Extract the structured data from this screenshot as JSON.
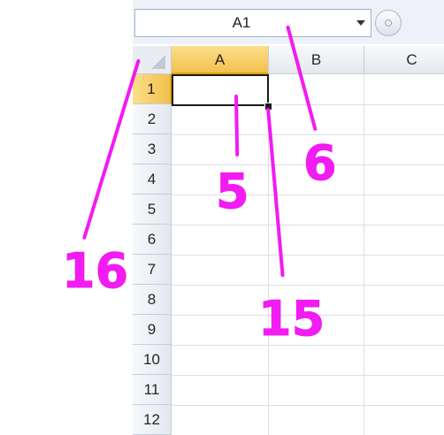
{
  "name_box": {
    "value": "A1",
    "dropdown_icon": "chevron-down-icon"
  },
  "formula_bar": {
    "button_icon": "circle-button-icon"
  },
  "columns": [
    {
      "label": "A",
      "active": true
    },
    {
      "label": "B",
      "active": false
    },
    {
      "label": "C",
      "active": false
    }
  ],
  "rows": [
    "1",
    "2",
    "3",
    "4",
    "5",
    "6",
    "7",
    "8",
    "9",
    "10",
    "11",
    "12"
  ],
  "active_cell": "A1",
  "annotations": {
    "label_5": "5",
    "label_6": "6",
    "label_15": "15",
    "label_16": "16",
    "color": "#f21bf2"
  },
  "colors": {
    "active_header": "#f2c04c",
    "header": "#e4e8ee",
    "gridline": "#dadfe6"
  }
}
